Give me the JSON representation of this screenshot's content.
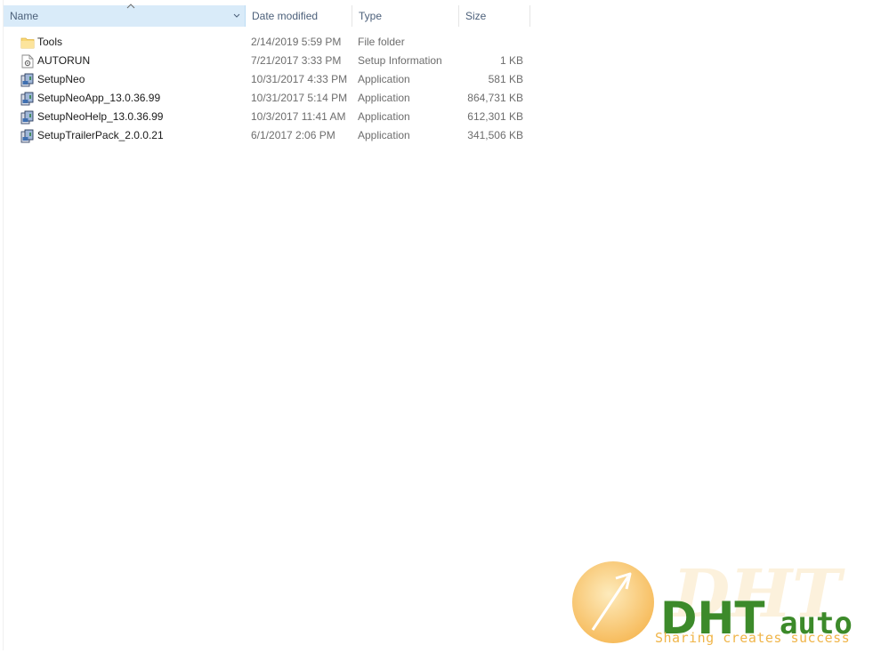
{
  "columns": {
    "name": "Name",
    "date": "Date modified",
    "type": "Type",
    "size": "Size"
  },
  "icons": {
    "sort": "chevron-up-icon",
    "filter": "chevron-down-icon",
    "folder": "folder-icon",
    "inf": "settings-file-icon",
    "app": "installer-icon"
  },
  "files": [
    {
      "name": "Tools",
      "date": "2/14/2019 5:59 PM",
      "type": "File folder",
      "size": "",
      "icon": "folder-icon"
    },
    {
      "name": "AUTORUN",
      "date": "7/21/2017 3:33 PM",
      "type": "Setup Information",
      "size": "1 KB",
      "icon": "settings-file-icon"
    },
    {
      "name": "SetupNeo",
      "date": "10/31/2017 4:33 PM",
      "type": "Application",
      "size": "581 KB",
      "icon": "installer-icon"
    },
    {
      "name": "SetupNeoApp_13.0.36.99",
      "date": "10/31/2017 5:14 PM",
      "type": "Application",
      "size": "864,731 KB",
      "icon": "installer-icon"
    },
    {
      "name": "SetupNeoHelp_13.0.36.99",
      "date": "10/3/2017 11:41 AM",
      "type": "Application",
      "size": "612,301 KB",
      "icon": "installer-icon"
    },
    {
      "name": "SetupTrailerPack_2.0.0.21",
      "date": "6/1/2017 2:06 PM",
      "type": "Application",
      "size": "341,506 KB",
      "icon": "installer-icon"
    }
  ],
  "watermark": {
    "logo_text": "DHT",
    "logo_suffix": "auto",
    "tagline": "Sharing creates success"
  },
  "colors": {
    "header_selected_bg": "#d9ebf9",
    "header_text": "#4c607a",
    "meta_text": "#6d6d6d",
    "folder_yellow": "#f8d775",
    "watermark_orange": "#f5b040",
    "watermark_green": "#3c8a2a"
  }
}
